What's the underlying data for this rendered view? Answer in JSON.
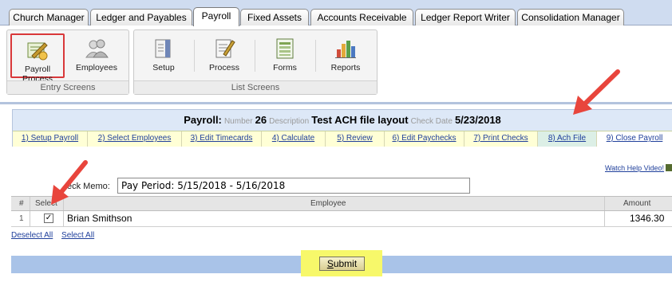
{
  "tabs": [
    {
      "label": "Church Manager"
    },
    {
      "label": "Ledger and Payables"
    },
    {
      "label": "Payroll"
    },
    {
      "label": "Fixed Assets"
    },
    {
      "label": "Accounts Receivable"
    },
    {
      "label": "Ledger Report Writer"
    },
    {
      "label": "Consolidation Manager"
    }
  ],
  "active_tab": "Payroll",
  "toolbar": {
    "entry_screens": {
      "label": "Entry Screens",
      "items": [
        {
          "label": "Payroll Process",
          "icon": "payroll-process-icon",
          "selected": true
        },
        {
          "label": "Employees",
          "icon": "employees-icon"
        }
      ]
    },
    "list_screens": {
      "label": "List Screens",
      "items": [
        {
          "label": "Setup",
          "icon": "setup-icon"
        },
        {
          "label": "Process",
          "icon": "process-icon"
        },
        {
          "label": "Forms",
          "icon": "forms-icon"
        },
        {
          "label": "Reports",
          "icon": "reports-icon"
        }
      ]
    }
  },
  "payroll": {
    "title": "Payroll:",
    "number_label": "Number",
    "number": "26",
    "description_label": "Description",
    "description": "Test ACH file layout",
    "check_date_label": "Check Date",
    "check_date": "5/23/2018"
  },
  "steps": [
    {
      "label": "1) Setup Payroll"
    },
    {
      "label": "2) Select Employees"
    },
    {
      "label": "3) Edit Timecards"
    },
    {
      "label": "4) Calculate"
    },
    {
      "label": "5) Review"
    },
    {
      "label": "6) Edit Paychecks"
    },
    {
      "label": "7) Print Checks"
    },
    {
      "label": "8) Ach File",
      "current": true
    },
    {
      "label": "9) Close Payroll"
    }
  ],
  "help_link": "Watch Help Video!",
  "check_memo": {
    "label": "eck Memo:",
    "value": "Pay Period: 5/15/2018 - 5/16/2018"
  },
  "grid": {
    "columns": [
      "#",
      "Select",
      "Employee",
      "Amount"
    ],
    "rows": [
      {
        "num": "1",
        "checked": "✓",
        "employee": "Brian Smithson",
        "amount": "1346.30"
      }
    ]
  },
  "deselect_all": "Deselect All",
  "select_all": "Select All",
  "submit": {
    "first": "S",
    "rest": "ubmit"
  },
  "colors": {
    "tabbar_bg": "#cfdcf0",
    "step_bg": "#ffffd6",
    "current_step_bg": "#dcefe6",
    "footer_bg": "#a9c3e8",
    "highlight": "#f7f86a",
    "annotation_arrow": "#e8453c"
  }
}
